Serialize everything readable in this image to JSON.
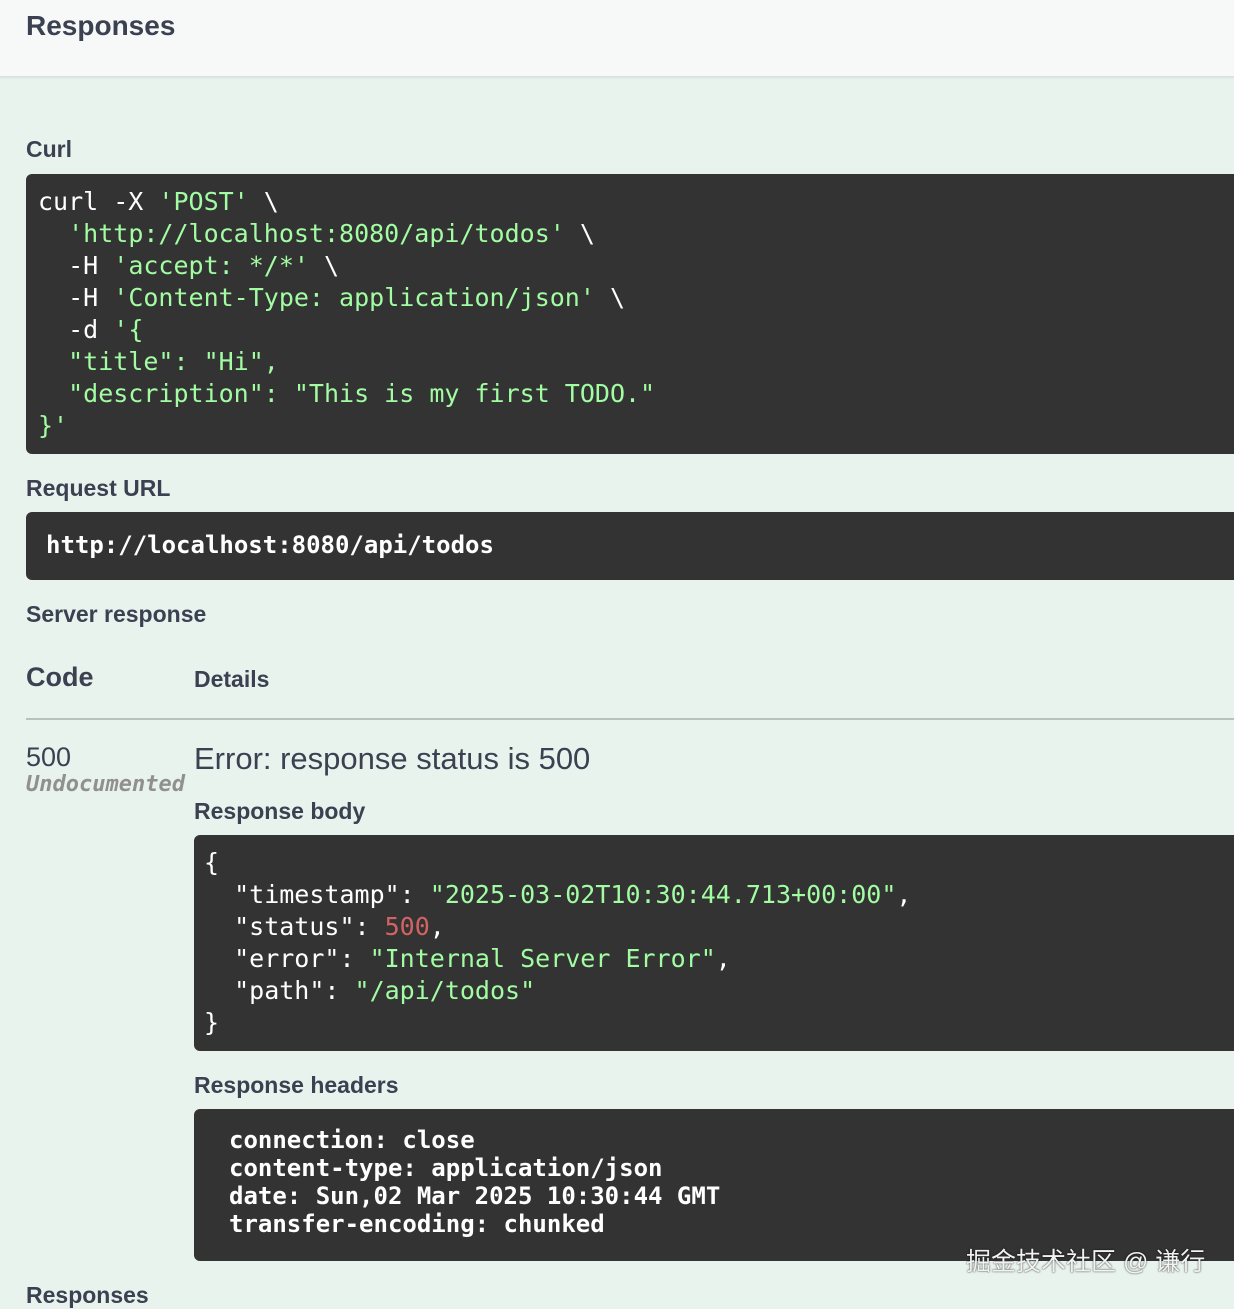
{
  "header": {
    "title": "Responses"
  },
  "curl": {
    "label": "Curl",
    "lines": [
      [
        {
          "t": "curl -X ",
          "c": "w"
        },
        {
          "t": "'POST'",
          "c": "g"
        },
        {
          "t": " \\",
          "c": "w"
        }
      ],
      [
        {
          "t": "  ",
          "c": "w"
        },
        {
          "t": "'http://localhost:8080/api/todos'",
          "c": "g"
        },
        {
          "t": " \\",
          "c": "w"
        }
      ],
      [
        {
          "t": "  -H ",
          "c": "w"
        },
        {
          "t": "'accept: */*'",
          "c": "g"
        },
        {
          "t": " \\",
          "c": "w"
        }
      ],
      [
        {
          "t": "  -H ",
          "c": "w"
        },
        {
          "t": "'Content-Type: application/json'",
          "c": "g"
        },
        {
          "t": " \\",
          "c": "w"
        }
      ],
      [
        {
          "t": "  -d ",
          "c": "w"
        },
        {
          "t": "'{",
          "c": "g"
        }
      ],
      [
        {
          "t": "  \"title\": \"Hi\",",
          "c": "g"
        }
      ],
      [
        {
          "t": "  \"description\": \"This is my first TODO.\"",
          "c": "g"
        }
      ],
      [
        {
          "t": "}'",
          "c": "g"
        }
      ]
    ]
  },
  "request_url": {
    "label": "Request URL",
    "value": "http://localhost:8080/api/todos"
  },
  "server_response": {
    "label": "Server response",
    "code_header": "Code",
    "details_header": "Details",
    "status_code": "500",
    "status_note": "Undocumented",
    "error_message": "Error: response status is 500",
    "body_label": "Response body",
    "body_lines": [
      [
        {
          "t": "{",
          "c": "w"
        }
      ],
      [
        {
          "t": "  \"timestamp\": ",
          "c": "w"
        },
        {
          "t": "\"2025-03-02T10:30:44.713+00:00\"",
          "c": "g"
        },
        {
          "t": ",",
          "c": "w"
        }
      ],
      [
        {
          "t": "  \"status\": ",
          "c": "w"
        },
        {
          "t": "500",
          "c": "r"
        },
        {
          "t": ",",
          "c": "w"
        }
      ],
      [
        {
          "t": "  \"error\": ",
          "c": "w"
        },
        {
          "t": "\"Internal Server Error\"",
          "c": "g"
        },
        {
          "t": ",",
          "c": "w"
        }
      ],
      [
        {
          "t": "  \"path\": ",
          "c": "w"
        },
        {
          "t": "\"/api/todos\"",
          "c": "g"
        }
      ],
      [
        {
          "t": "}",
          "c": "w"
        }
      ]
    ],
    "headers_label": "Response headers",
    "header_lines": [
      "connection: close",
      "content-type: application/json",
      "date: Sun,02 Mar 2025 10:30:44 GMT",
      "transfer-encoding: chunked"
    ]
  },
  "footer": {
    "responses_label": "Responses"
  },
  "watermark": "掘金技术社区 @ 谦行",
  "colors": {
    "background": "#e8f3ee",
    "code_background": "#333333",
    "string_green": "#a2fca2",
    "number_red": "#d36363",
    "text_dark": "#3b4151"
  }
}
